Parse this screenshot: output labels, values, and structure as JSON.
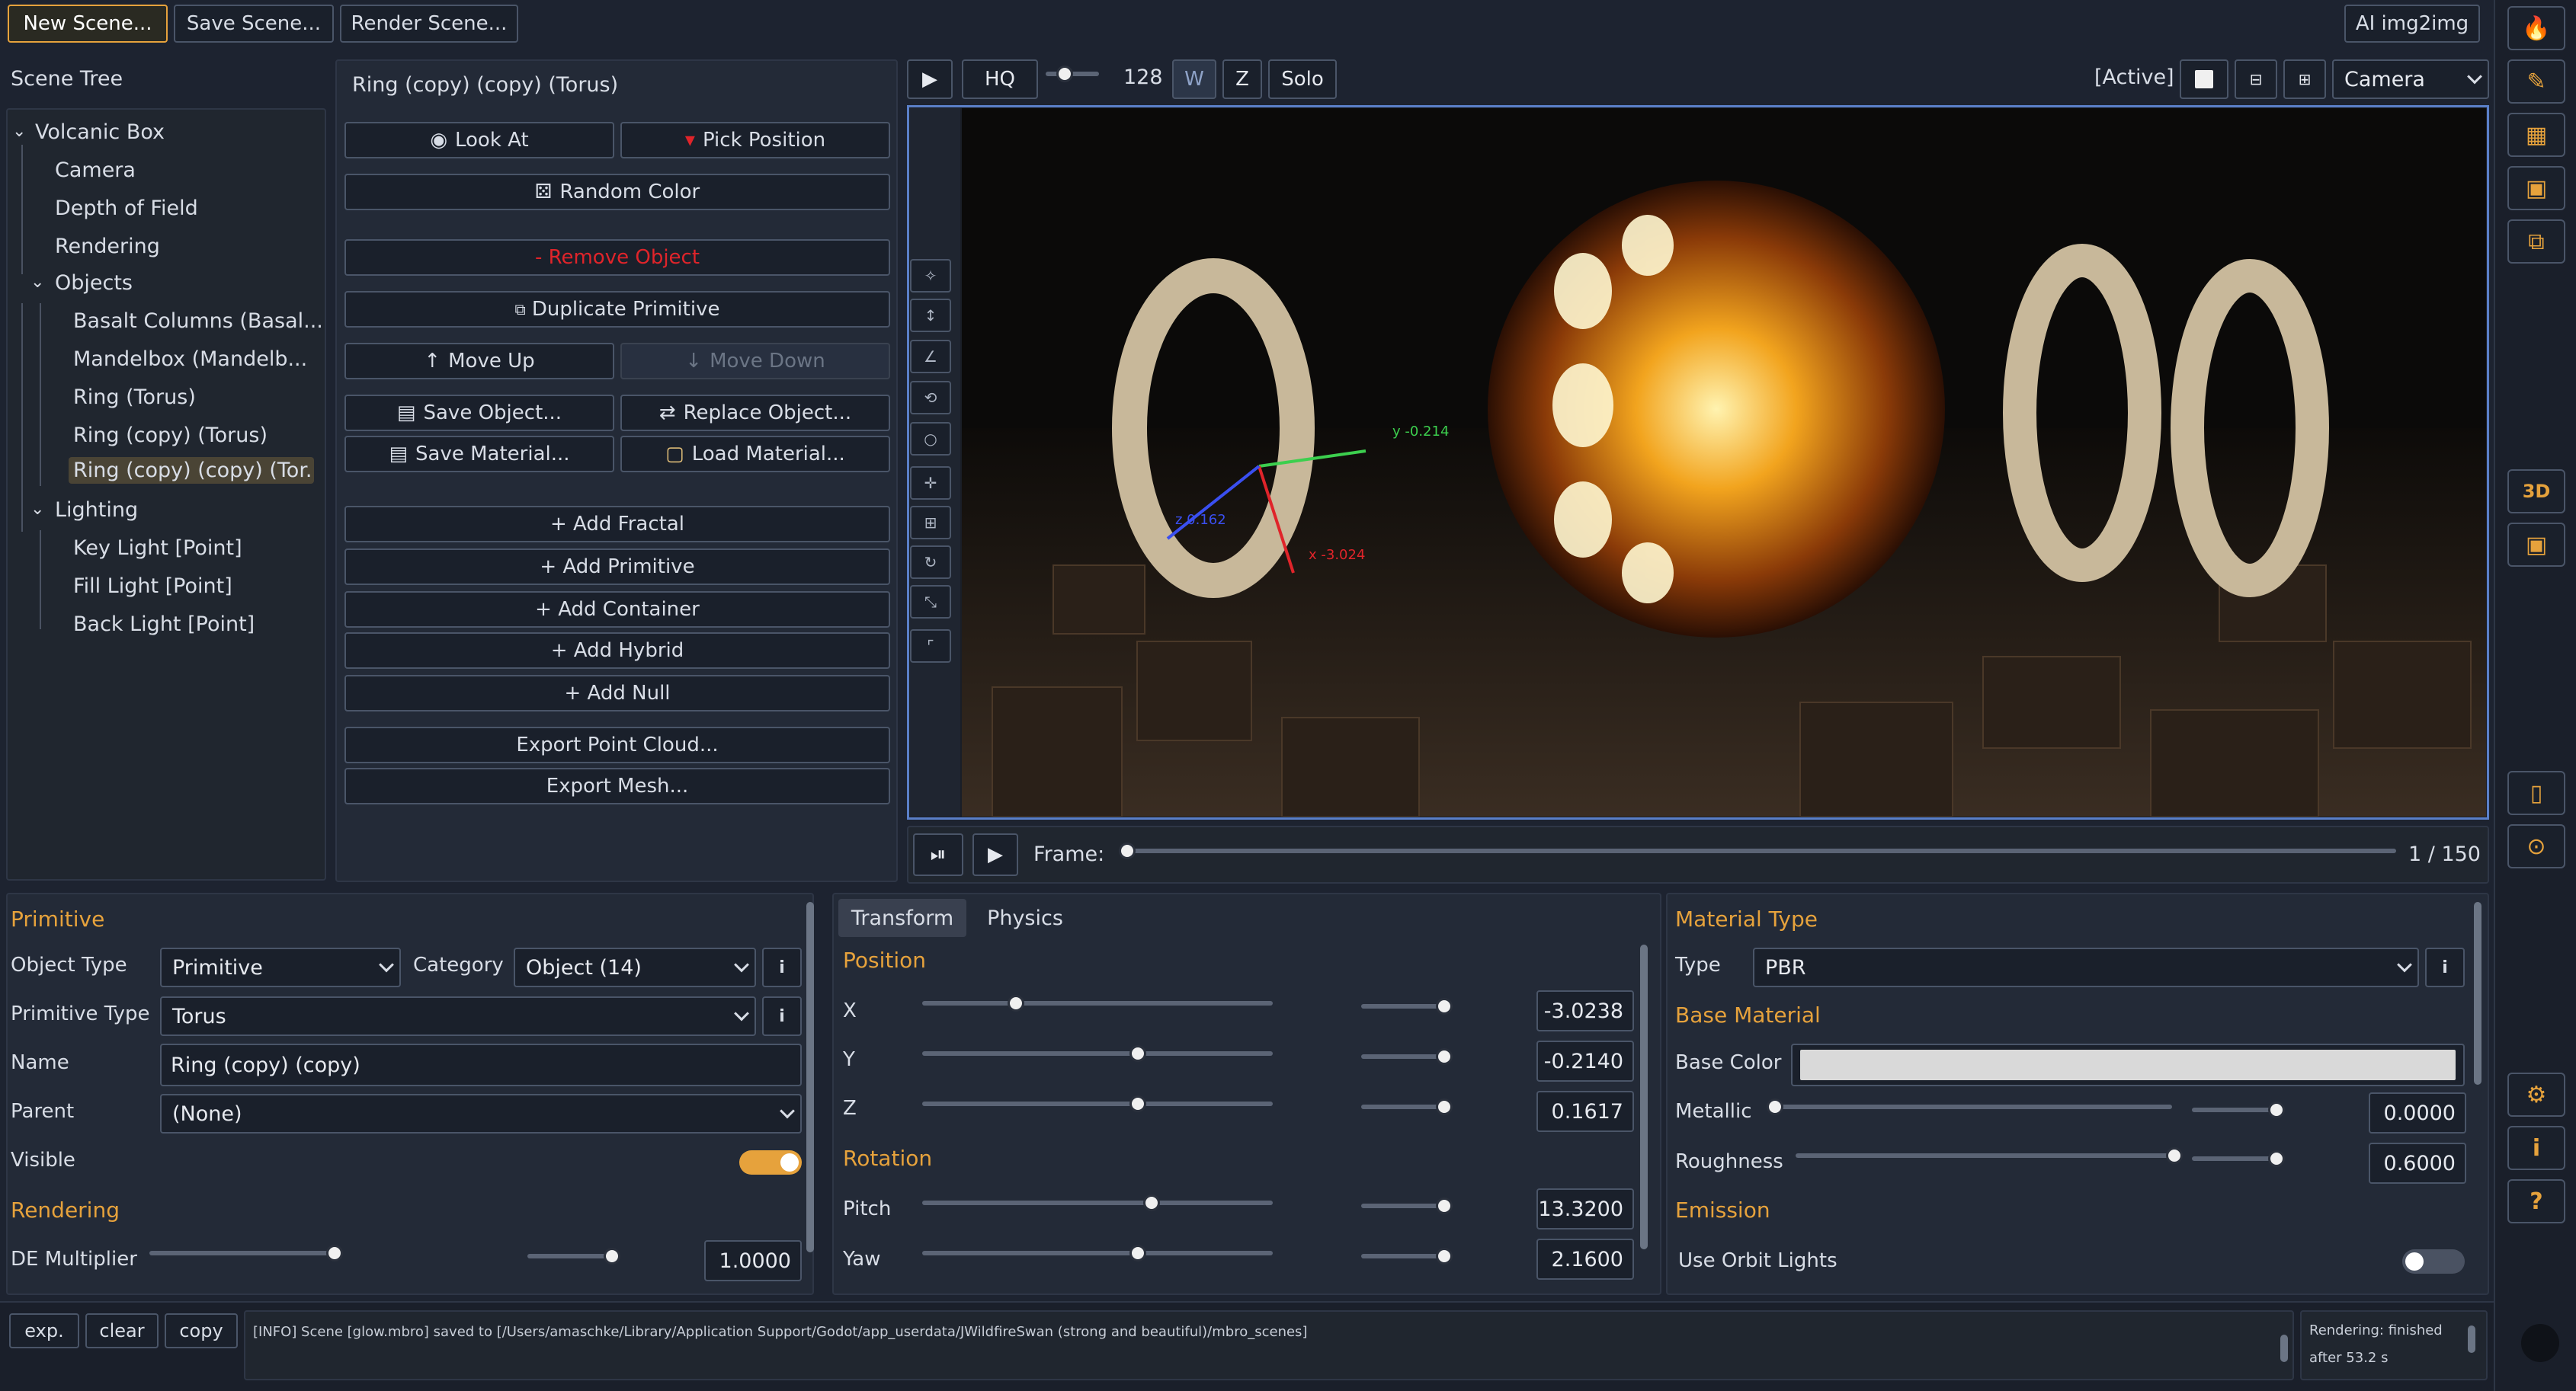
{
  "toolbar": {
    "new_scene": "New Scene...",
    "save_scene": "Save Scene...",
    "render_scene": "Render Scene...",
    "ai_img2img": "AI img2img"
  },
  "scene_tree": {
    "title": "Scene Tree",
    "items": [
      {
        "label": "Volcanic Box"
      },
      {
        "label": "Camera"
      },
      {
        "label": "Depth of Field"
      },
      {
        "label": "Rendering"
      },
      {
        "label": "Objects"
      },
      {
        "label": "Basalt Columns (Basal..."
      },
      {
        "label": "Mandelbox (Mandelb..."
      },
      {
        "label": "Ring (Torus)"
      },
      {
        "label": "Ring (copy) (Torus)"
      },
      {
        "label": "Ring (copy) (copy) (Tor..."
      },
      {
        "label": "Lighting"
      },
      {
        "label": "Key Light [Point]"
      },
      {
        "label": "Fill Light [Point]"
      },
      {
        "label": "Back Light [Point]"
      }
    ]
  },
  "object_panel": {
    "title": "Ring (copy) (copy) (Torus)",
    "look_at": "Look At",
    "pick_position": "Pick Position",
    "random_color": "Random Color",
    "remove_object": "- Remove Object",
    "duplicate_primitive": "Duplicate Primitive",
    "move_up": "Move Up",
    "move_down": "Move Down",
    "save_object": "Save Object...",
    "replace_object": "Replace Object...",
    "save_material": "Save Material...",
    "load_material": "Load Material...",
    "add_fractal": "+ Add Fractal",
    "add_primitive": "+ Add Primitive",
    "add_container": "+ Add Container",
    "add_hybrid": "+ Add Hybrid",
    "add_null": "+ Add Null",
    "export_point_cloud": "Export Point Cloud...",
    "export_mesh": "Export Mesh..."
  },
  "viewport": {
    "hq": "HQ",
    "samples": "128",
    "samples_fraction": 0.2,
    "w": "W",
    "z": "Z",
    "solo": "Solo",
    "active": "[Active]",
    "camera": "Camera",
    "gizmo_y": "y -0.214",
    "gizmo_x": "x -3.024",
    "gizmo_z": "z 0.162"
  },
  "timeline": {
    "frame_label": "Frame:",
    "frame_count": "1 / 150",
    "frame_fraction": 0.0
  },
  "primitive": {
    "section": "Primitive",
    "object_type_label": "Object Type",
    "object_type": "Primitive",
    "category_label": "Category",
    "category": "Object (14)",
    "primitive_type_label": "Primitive Type",
    "primitive_type": "Torus",
    "name_label": "Name",
    "name": "Ring (copy) (copy)",
    "parent_label": "Parent",
    "parent": "(None)",
    "visible_label": "Visible",
    "visible": true,
    "rendering_section": "Rendering",
    "de_multiplier_label": "DE Multiplier",
    "de_multiplier": "1.0000",
    "info": "i"
  },
  "transform": {
    "tab_transform": "Transform",
    "tab_physics": "Physics",
    "position_section": "Position",
    "x_label": "X",
    "x": "-3.0238",
    "y_label": "Y",
    "y": "-0.2140",
    "z_label": "Z",
    "z": "0.1617",
    "rotation_section": "Rotation",
    "pitch_label": "Pitch",
    "pitch": "13.3200",
    "yaw_label": "Yaw",
    "yaw": "2.1600"
  },
  "material": {
    "section": "Material Type",
    "type_label": "Type",
    "type": "PBR",
    "base_section": "Base Material",
    "base_color_label": "Base Color",
    "base_color": "#d9d9d9",
    "metallic_label": "Metallic",
    "metallic": "0.0000",
    "roughness_label": "Roughness",
    "roughness": "0.6000",
    "emission_section": "Emission",
    "orbit_lights_label": "Use Orbit Lights",
    "orbit_lights": false,
    "info": "i"
  },
  "log": {
    "exp": "exp.",
    "clear": "clear",
    "copy": "copy",
    "message": "[INFO] Scene [glow.mbro] saved to [/Users/amaschke/Library/Application Support/Godot/app_userdata/JWildfireSwan (strong and beautiful)/mbro_scenes]",
    "status_line1": "Rendering:  finished",
    "status_line2": "after 53.2 s"
  },
  "colors": {
    "accent": "#e6a23c",
    "danger": "#e0242a",
    "background": "#1d2330"
  }
}
